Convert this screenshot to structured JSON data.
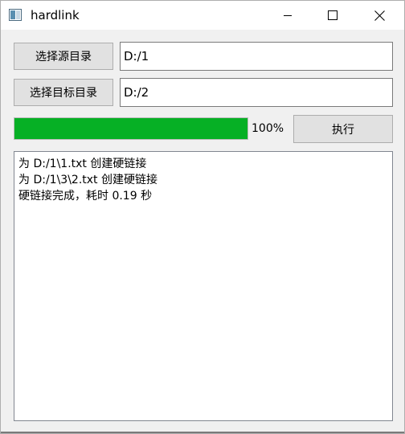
{
  "window": {
    "title": "hardlink",
    "icon": "app-window-icon",
    "controls": {
      "minimize_icon": "minimize-icon",
      "maximize_icon": "maximize-icon",
      "close_icon": "close-icon"
    }
  },
  "source": {
    "button_label": "选择源目录",
    "path_value": "D:/1"
  },
  "target": {
    "button_label": "选择目标目录",
    "path_value": "D:/2"
  },
  "progress": {
    "value": 1.0,
    "text": "100%",
    "fill_color": "#06b025"
  },
  "execute": {
    "button_label": "执行"
  },
  "log": {
    "lines": [
      "为 D:/1\\1.txt 创建硬链接",
      "为 D:/1\\3\\2.txt 创建硬链接",
      "硬链接完成，耗时 0.19 秒"
    ]
  }
}
